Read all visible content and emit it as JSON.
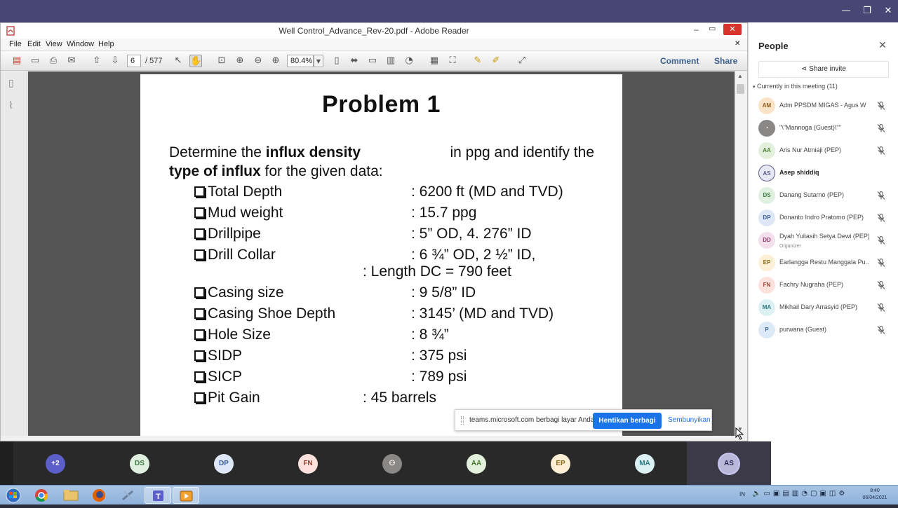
{
  "teams": {
    "window_controls": {
      "minimize": "—",
      "maximize": "❐",
      "close": "✕"
    }
  },
  "reader": {
    "title": "Well Control_Advance_Rev-20.pdf - Adobe Reader",
    "menu": [
      "File",
      "Edit",
      "View",
      "Window",
      "Help"
    ],
    "page_current": "6",
    "page_total": "/ 577",
    "zoom": "80.4%",
    "comment_label": "Comment",
    "share_label": "Share"
  },
  "slide": {
    "title": "Problem  1",
    "intro_1a": "Determine the ",
    "intro_1b": "influx density",
    "intro_1c": " in ppg and identify the",
    "intro_2a": "type of influx",
    "intro_2b": " for the given data:",
    "rows": [
      {
        "label": "Total Depth",
        "value": ": 6200 ft (MD and TVD)"
      },
      {
        "label": "Mud weight",
        "value": ": 15.7 ppg"
      },
      {
        "label": "Drillpipe",
        "value": ": 5” OD, 4. 276” ID"
      },
      {
        "label": "Drill Collar",
        "value": ": 6 ¾” OD, 2 ½” ID,"
      },
      {
        "label": "",
        "value": ": Length DC = 790 feet"
      },
      {
        "label": "Casing size",
        "value": ": 9 5/8” ID"
      },
      {
        "label": "Casing Shoe Depth",
        "value": ": 3145’ (MD and TVD)"
      },
      {
        "label": "Hole Size",
        "value": ": 8 ¾”"
      },
      {
        "label": "SIDP",
        "value": ": 375 psi"
      },
      {
        "label": "SICP",
        "value": ": 789 psi"
      },
      {
        "label": "Pit Gain",
        "value": ": 45 barrels"
      }
    ]
  },
  "share_notice": {
    "message": "teams.microsoft.com berbagi layar Anda.",
    "stop_label": "Hentikan berbagi",
    "hide_label": "Sembunyikan"
  },
  "people": {
    "title": "People",
    "share_invite": "Share invite",
    "meeting_header": "Currently in this meeting  (11)",
    "members": [
      {
        "initials": "AM",
        "name": "Adm PPSDM MIGAS - Agus W",
        "color": "#fbe3c7",
        "fg": "#8a5a1c",
        "role": ""
      },
      {
        "initials": "",
        "name": "\"\\\"Mannoga (Guest)\\\"\"",
        "color": "#8a8886",
        "fg": "#ffffff",
        "role": ""
      },
      {
        "initials": "AA",
        "name": "Aris Nur Atmiaji (PEP)",
        "color": "#e3f1dc",
        "fg": "#4b7a34",
        "role": ""
      },
      {
        "initials": "AS",
        "name": "Asep shiddiq",
        "color": "#e8e8f5",
        "fg": "#5d5d8a",
        "role": "",
        "bold": true
      },
      {
        "initials": "DS",
        "name": "Danang Sutarno (PEP)",
        "color": "#dff0e0",
        "fg": "#3f7a44",
        "role": ""
      },
      {
        "initials": "DP",
        "name": "Donanto Indro Pratomo (PEP)",
        "color": "#dde7f6",
        "fg": "#3b5f9a",
        "role": ""
      },
      {
        "initials": "DD",
        "name": "Dyah Yuliasih Setya Dewi (PEP)",
        "color": "#f3e0ec",
        "fg": "#8a3f6c",
        "role": "Organizer"
      },
      {
        "initials": "EP",
        "name": "Earlangga Restu Manggala Pu...",
        "color": "#fdf0d6",
        "fg": "#8a6a1c",
        "role": ""
      },
      {
        "initials": "FN",
        "name": "Fachry Nugraha (PEP)",
        "color": "#fde1dc",
        "fg": "#9a4435",
        "role": ""
      },
      {
        "initials": "MA",
        "name": "Mikhail Dary Arrasyid (PEP)",
        "color": "#dcf1f3",
        "fg": "#2e7a82",
        "role": ""
      },
      {
        "initials": "P",
        "name": "purwana (Guest)",
        "color": "#dceaf8",
        "fg": "#3d6aa0",
        "role": ""
      }
    ]
  },
  "video_strip": [
    {
      "initials": "+2",
      "color": "#5b5fc7",
      "fg": "#ffffff"
    },
    {
      "initials": "DS",
      "color": "#dff0e0",
      "fg": "#3f7a44"
    },
    {
      "initials": "DP",
      "color": "#dde7f6",
      "fg": "#3b5f9a"
    },
    {
      "initials": "FN",
      "color": "#fde1dc",
      "fg": "#9a4435"
    },
    {
      "initials": "",
      "color": "#8a8886",
      "fg": "#ffffff"
    },
    {
      "initials": "AA",
      "color": "#e3f1dc",
      "fg": "#4b7a34"
    },
    {
      "initials": "EP",
      "color": "#fdf0d6",
      "fg": "#8a6a1c"
    },
    {
      "initials": "MA",
      "color": "#dcf1f3",
      "fg": "#2e7a82"
    },
    {
      "initials": "AS",
      "color": "#b9b8d9",
      "fg": "#2b2a55"
    }
  ],
  "taskbar": {
    "language": "IN",
    "time": "8:40",
    "date": "06/04/2021"
  }
}
